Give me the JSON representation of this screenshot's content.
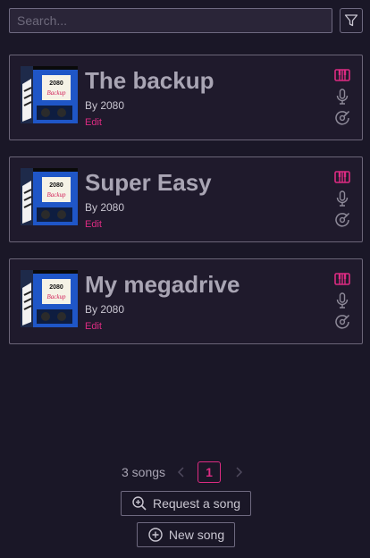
{
  "search": {
    "placeholder": "Search..."
  },
  "songs": [
    {
      "title": "The backup",
      "artist": "By 2080",
      "edit_label": "Edit",
      "cover_text": "2080 Backup"
    },
    {
      "title": "Super Easy",
      "artist": "By 2080",
      "edit_label": "Edit",
      "cover_text": "2080 Backup"
    },
    {
      "title": "My megadrive",
      "artist": "By 2080",
      "edit_label": "Edit",
      "cover_text": "2080 Backup"
    }
  ],
  "song_icons": [
    "piano-icon",
    "microphone-icon",
    "drum-icon"
  ],
  "pagination": {
    "count_label": "3 songs",
    "current_page": "1"
  },
  "actions": {
    "request_label": "Request a song",
    "new_label": "New song"
  },
  "colors": {
    "accent": "#dc2b82",
    "background": "#1a1727",
    "card": "#1f1a2c",
    "border": "#6b6578"
  }
}
